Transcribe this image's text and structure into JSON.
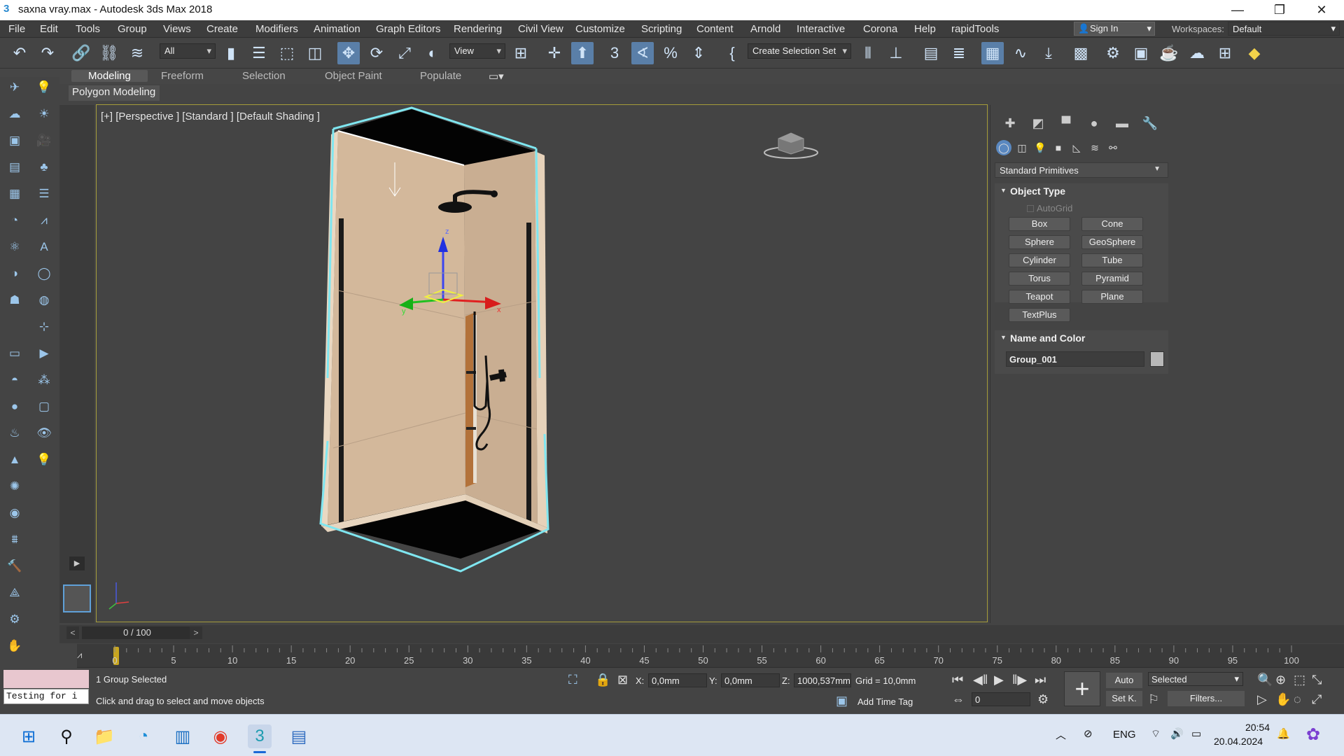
{
  "window": {
    "title": "saxna vray.max - Autodesk 3ds Max 2018",
    "logo_glyph": "3",
    "minimize": "—",
    "maximize": "❐",
    "close": "✕"
  },
  "menu": [
    "File",
    "Edit",
    "Tools",
    "Group",
    "Views",
    "Create",
    "Modifiers",
    "Animation",
    "Graph Editors",
    "Rendering",
    "Civil View",
    "Customize",
    "Scripting",
    "Content",
    "Arnold",
    "Interactive",
    "Corona",
    "Help",
    "rapidTools"
  ],
  "account": {
    "sign_in": "Sign In",
    "workspaces_label": "Workspaces:",
    "workspace": "Default"
  },
  "toolbar": {
    "selection_filter": "All",
    "ref_coord": "View",
    "named_selection": "Create Selection Set",
    "snap_3": "3",
    "snap_angle": "∢",
    "snap_percent": "%"
  },
  "ribbon": {
    "tabs": [
      "Modeling",
      "Freeform",
      "Selection",
      "Object Paint",
      "Populate"
    ],
    "active_tab": "Modeling",
    "subtab": "Polygon Modeling"
  },
  "viewport": {
    "label": "[+] [Perspective ] [Standard ] [Default Shading ]",
    "gizmo": {
      "x": "x",
      "y": "y",
      "z": "z"
    }
  },
  "command_panel": {
    "category_dropdown": "Standard Primitives",
    "object_type": {
      "title": "Object Type",
      "autogrid": "AutoGrid",
      "buttons": [
        "Box",
        "Cone",
        "Sphere",
        "GeoSphere",
        "Cylinder",
        "Tube",
        "Torus",
        "Pyramid",
        "Teapot",
        "Plane",
        "TextPlus"
      ]
    },
    "name_and_color": {
      "title": "Name and Color",
      "name": "Group_001",
      "color": "#b8b8b8"
    }
  },
  "time": {
    "frame_display": "0 / 100",
    "ticks": [
      "0",
      "5",
      "10",
      "15",
      "20",
      "25",
      "30",
      "35",
      "40",
      "45",
      "50",
      "55",
      "60",
      "65",
      "70",
      "75",
      "80",
      "85",
      "90",
      "95",
      "100"
    ]
  },
  "status": {
    "selection": "1 Group Selected",
    "prompt": "Click and drag to select and move objects",
    "maxscript_text": "Testing for i",
    "x_label": "X:",
    "x_value": "0,0mm",
    "y_label": "Y:",
    "y_value": "0,0mm",
    "z_label": "Z:",
    "z_value": "1000,537mm",
    "grid": "Grid = 10,0mm",
    "add_time_tag": "Add Time Tag",
    "auto": "Auto",
    "set_key": "Set K.",
    "selected_dd": "Selected",
    "filters": "Filters...",
    "frame_field": "0"
  },
  "taskbar": {
    "lang": "ENG",
    "time": "20:54",
    "date": "20.04.2024"
  },
  "colors": {
    "viewport_border": "#a59c3a",
    "selection_bracket": "#7fe6f0",
    "wall": "#d2b79b",
    "active_ribbon": "#585858"
  }
}
